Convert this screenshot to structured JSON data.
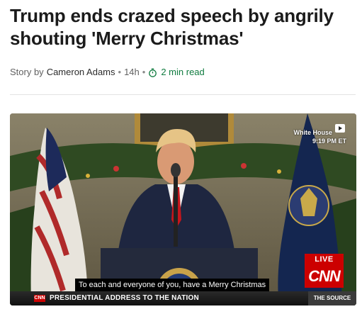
{
  "article": {
    "headline": "Trump ends crazed speech by angrily shouting 'Merry Christmas'",
    "byline_prefix": "Story by",
    "author": "Cameron Adams",
    "age": "14h",
    "read_time": "2 min read"
  },
  "video": {
    "location_line1": "White House",
    "location_line2": "9:19 PM ET",
    "live_label": "LIVE",
    "network_logo": "CNN",
    "caption": "To each and everyone of you, have a Merry Christmas",
    "chyron_logo": "CNN",
    "chyron_text": "PRESIDENTIAL ADDRESS TO THE NATION",
    "chyron_source": "THE SOURCE"
  },
  "colors": {
    "read_time": "#0f7b3f",
    "cnn_red": "#cc0000"
  }
}
